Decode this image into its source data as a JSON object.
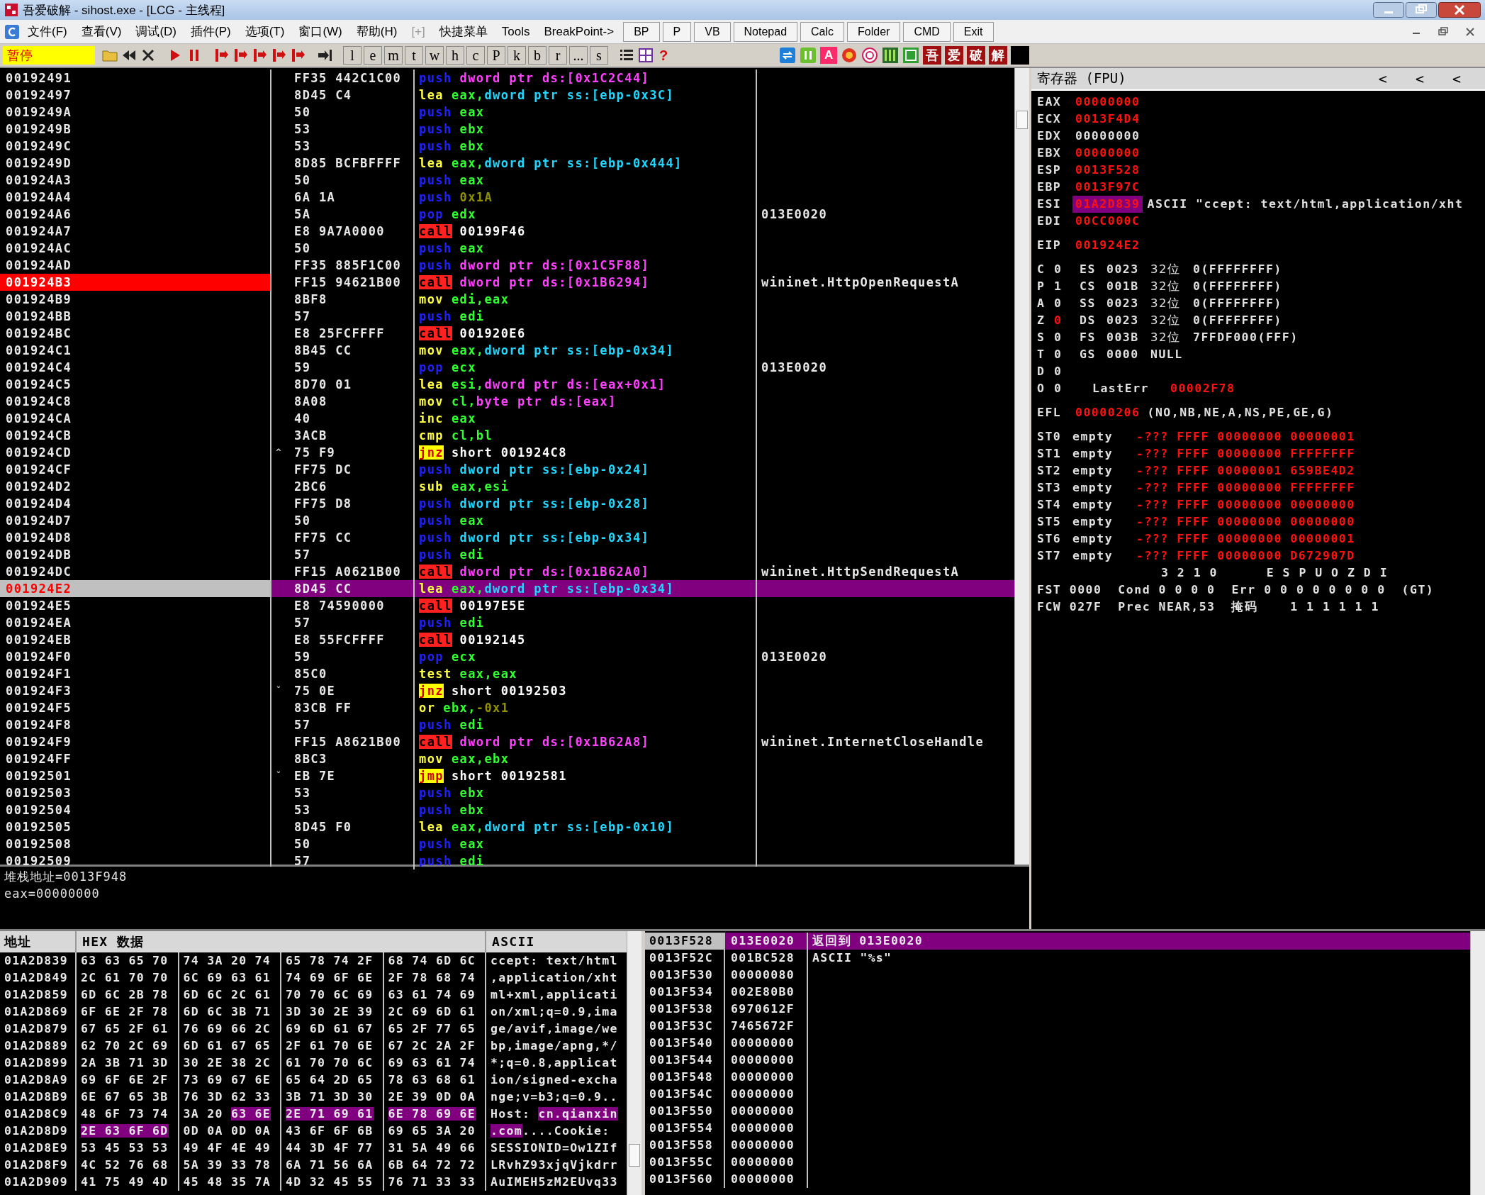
{
  "window": {
    "title": "吾爱破解 - sihost.exe - [LCG - 主线程]"
  },
  "menu": [
    {
      "label": "文件(F)",
      "disabled": false
    },
    {
      "label": "查看(V)",
      "disabled": false
    },
    {
      "label": "调试(D)",
      "disabled": false
    },
    {
      "label": "插件(P)",
      "disabled": false
    },
    {
      "label": "选项(T)",
      "disabled": false
    },
    {
      "label": "窗口(W)",
      "disabled": false
    },
    {
      "label": "帮助(H)",
      "disabled": false
    },
    {
      "label": "[+]",
      "disabled": true
    },
    {
      "label": "快捷菜单",
      "disabled": false
    },
    {
      "label": "Tools",
      "disabled": false
    },
    {
      "label": "BreakPoint->",
      "disabled": false
    }
  ],
  "quick_buttons": [
    "BP",
    "P",
    "VB",
    "Notepad",
    "Calc",
    "Folder",
    "CMD",
    "Exit"
  ],
  "toolbar": {
    "status": "暂停",
    "letter_buttons": [
      "l",
      "e",
      "m",
      "t",
      "w",
      "h",
      "c",
      "P",
      "k",
      "b",
      "r",
      "...",
      "s"
    ],
    "help_button": "?",
    "letter_icon": "A",
    "brand_buttons": [
      "吾",
      "爱",
      "破",
      "解"
    ]
  },
  "disassembly": {
    "rows": [
      {
        "address": "00192491",
        "bytes": "FF35 442C1C00",
        "mnemonic": {
          "text": "push",
          "kind": "stack"
        },
        "operands": [
          {
            "text": "dword ptr ds:[0x1C2C44]",
            "kind": "ds_mem"
          }
        ],
        "breakpoint": false,
        "selected": false
      },
      {
        "address": "00192497",
        "bytes": "8D45 C4",
        "mnemonic": {
          "text": "lea",
          "kind": "plain"
        },
        "operands": [
          {
            "text": "eax,",
            "kind": "reg"
          },
          {
            "text": "dword ptr ss:[ebp-0x3C]",
            "kind": "ss_mem"
          }
        ],
        "breakpoint": false,
        "selected": false
      },
      {
        "address": "0019249A",
        "bytes": "50",
        "mnemonic": {
          "text": "push",
          "kind": "stack"
        },
        "operands": [
          {
            "text": "eax",
            "kind": "reg"
          }
        ],
        "breakpoint": false,
        "selected": false
      },
      {
        "address": "0019249B",
        "bytes": "53",
        "mnemonic": {
          "text": "push",
          "kind": "stack"
        },
        "operands": [
          {
            "text": "ebx",
            "kind": "reg"
          }
        ],
        "breakpoint": false,
        "selected": false
      },
      {
        "address": "0019249C",
        "bytes": "53",
        "mnemonic": {
          "text": "push",
          "kind": "stack"
        },
        "operands": [
          {
            "text": "ebx",
            "kind": "reg"
          }
        ],
        "breakpoint": false,
        "selected": false
      },
      {
        "address": "0019249D",
        "bytes": "8D85 BCFBFFFF",
        "mnemonic": {
          "text": "lea",
          "kind": "plain"
        },
        "operands": [
          {
            "text": "eax,",
            "kind": "reg"
          },
          {
            "text": "dword ptr ss:[ebp-0x444]",
            "kind": "ss_mem"
          }
        ],
        "breakpoint": false,
        "selected": false
      },
      {
        "address": "001924A3",
        "bytes": "50",
        "mnemonic": {
          "text": "push",
          "kind": "stack"
        },
        "operands": [
          {
            "text": "eax",
            "kind": "reg"
          }
        ],
        "breakpoint": false,
        "selected": false
      },
      {
        "address": "001924A4",
        "bytes": "6A 1A",
        "mnemonic": {
          "text": "push",
          "kind": "stack"
        },
        "operands": [
          {
            "text": "0x1A",
            "kind": "imm"
          }
        ],
        "breakpoint": false,
        "selected": false
      },
      {
        "address": "001924A6",
        "bytes": "5A",
        "mnemonic": {
          "text": "pop",
          "kind": "stack"
        },
        "operands": [
          {
            "text": "edx",
            "kind": "reg"
          }
        ],
        "comment": "013E0020",
        "breakpoint": false,
        "selected": false
      },
      {
        "address": "001924A7",
        "bytes": "E8 9A7A0000",
        "mnemonic": {
          "text": "call",
          "kind": "call"
        },
        "operands": [
          {
            "text": "00199F46",
            "kind": "target"
          }
        ],
        "breakpoint": false,
        "selected": false
      },
      {
        "address": "001924AC",
        "bytes": "50",
        "mnemonic": {
          "text": "push",
          "kind": "stack"
        },
        "operands": [
          {
            "text": "eax",
            "kind": "reg"
          }
        ],
        "breakpoint": false,
        "selected": false
      },
      {
        "address": "001924AD",
        "bytes": "FF35 885F1C00",
        "mnemonic": {
          "text": "push",
          "kind": "stack"
        },
        "operands": [
          {
            "text": "dword ptr ds:[0x1C5F88]",
            "kind": "ds_mem"
          }
        ],
        "breakpoint": false,
        "selected": false
      },
      {
        "address": "001924B3",
        "bytes": "FF15 94621B00",
        "mnemonic": {
          "text": "call",
          "kind": "call"
        },
        "operands": [
          {
            "text": "dword ptr ds:[0x1B6294]",
            "kind": "ds_mem"
          }
        ],
        "comment": "wininet.HttpOpenRequestA",
        "breakpoint": true,
        "selected": false
      },
      {
        "address": "001924B9",
        "bytes": "8BF8",
        "mnemonic": {
          "text": "mov",
          "kind": "plain"
        },
        "operands": [
          {
            "text": "edi,eax",
            "kind": "reg"
          }
        ],
        "breakpoint": false,
        "selected": false
      },
      {
        "address": "001924BB",
        "bytes": "57",
        "mnemonic": {
          "text": "push",
          "kind": "stack"
        },
        "operands": [
          {
            "text": "edi",
            "kind": "reg"
          }
        ],
        "breakpoint": false,
        "selected": false
      },
      {
        "address": "001924BC",
        "bytes": "E8 25FCFFFF",
        "mnemonic": {
          "text": "call",
          "kind": "call"
        },
        "operands": [
          {
            "text": "001920E6",
            "kind": "target"
          }
        ],
        "breakpoint": false,
        "selected": false
      },
      {
        "address": "001924C1",
        "bytes": "8B45 CC",
        "mnemonic": {
          "text": "mov",
          "kind": "plain"
        },
        "operands": [
          {
            "text": "eax,",
            "kind": "reg"
          },
          {
            "text": "dword ptr ss:[ebp-0x34]",
            "kind": "ss_mem"
          }
        ],
        "breakpoint": false,
        "selected": false
      },
      {
        "address": "001924C4",
        "bytes": "59",
        "mnemonic": {
          "text": "pop",
          "kind": "stack"
        },
        "operands": [
          {
            "text": "ecx",
            "kind": "reg"
          }
        ],
        "comment": "013E0020",
        "breakpoint": false,
        "selected": false
      },
      {
        "address": "001924C5",
        "bytes": "8D70 01",
        "mnemonic": {
          "text": "lea",
          "kind": "plain"
        },
        "operands": [
          {
            "text": "esi,",
            "kind": "reg"
          },
          {
            "text": "dword ptr ds:[eax+0x1]",
            "kind": "ds_mem"
          }
        ],
        "breakpoint": false,
        "selected": false
      },
      {
        "address": "001924C8",
        "bytes": "8A08",
        "mnemonic": {
          "text": "mov",
          "kind": "plain"
        },
        "operands": [
          {
            "text": "cl,",
            "kind": "reg"
          },
          {
            "text": "byte ptr ds:[eax]",
            "kind": "ds_mem"
          }
        ],
        "breakpoint": false,
        "selected": false
      },
      {
        "address": "001924CA",
        "bytes": "40",
        "mnemonic": {
          "text": "inc",
          "kind": "plain"
        },
        "operands": [
          {
            "text": "eax",
            "kind": "reg"
          }
        ],
        "breakpoint": false,
        "selected": false
      },
      {
        "address": "001924CB",
        "bytes": "3ACB",
        "mnemonic": {
          "text": "cmp",
          "kind": "plain"
        },
        "operands": [
          {
            "text": "cl,bl",
            "kind": "reg"
          }
        ],
        "breakpoint": false,
        "selected": false
      },
      {
        "address": "001924CD",
        "jump_mark": "^",
        "bytes": "75 F9",
        "mnemonic": {
          "text": "jnz",
          "kind": "jump"
        },
        "operands": [
          {
            "text": "short 001924C8",
            "kind": "target"
          }
        ],
        "breakpoint": false,
        "selected": false
      },
      {
        "address": "001924CF",
        "bytes": "FF75 DC",
        "mnemonic": {
          "text": "push",
          "kind": "stack"
        },
        "operands": [
          {
            "text": "dword ptr ss:[ebp-0x24]",
            "kind": "ss_mem"
          }
        ],
        "breakpoint": false,
        "selected": false
      },
      {
        "address": "001924D2",
        "bytes": "2BC6",
        "mnemonic": {
          "text": "sub",
          "kind": "plain"
        },
        "operands": [
          {
            "text": "eax,esi",
            "kind": "reg"
          }
        ],
        "breakpoint": false,
        "selected": false
      },
      {
        "address": "001924D4",
        "bytes": "FF75 D8",
        "mnemonic": {
          "text": "push",
          "kind": "stack"
        },
        "operands": [
          {
            "text": "dword ptr ss:[ebp-0x28]",
            "kind": "ss_mem"
          }
        ],
        "breakpoint": false,
        "selected": false
      },
      {
        "address": "001924D7",
        "bytes": "50",
        "mnemonic": {
          "text": "push",
          "kind": "stack"
        },
        "operands": [
          {
            "text": "eax",
            "kind": "reg"
          }
        ],
        "breakpoint": false,
        "selected": false
      },
      {
        "address": "001924D8",
        "bytes": "FF75 CC",
        "mnemonic": {
          "text": "push",
          "kind": "stack"
        },
        "operands": [
          {
            "text": "dword ptr ss:[ebp-0x34]",
            "kind": "ss_mem"
          }
        ],
        "breakpoint": false,
        "selected": false
      },
      {
        "address": "001924DB",
        "bytes": "57",
        "mnemonic": {
          "text": "push",
          "kind": "stack"
        },
        "operands": [
          {
            "text": "edi",
            "kind": "reg"
          }
        ],
        "breakpoint": false,
        "selected": false
      },
      {
        "address": "001924DC",
        "bytes": "FF15 A0621B00",
        "mnemonic": {
          "text": "call",
          "kind": "call"
        },
        "operands": [
          {
            "text": "dword ptr ds:[0x1B62A0]",
            "kind": "ds_mem"
          }
        ],
        "comment": "wininet.HttpSendRequestA",
        "breakpoint": false,
        "selected": false
      },
      {
        "address": "001924E2",
        "bytes": "8D45 CC",
        "mnemonic": {
          "text": "lea",
          "kind": "plain"
        },
        "operands": [
          {
            "text": "eax,",
            "kind": "reg"
          },
          {
            "text": "dword ptr ss:[ebp-0x34]",
            "kind": "ss_mem"
          }
        ],
        "breakpoint": false,
        "selected": true
      },
      {
        "address": "001924E5",
        "bytes": "E8 74590000",
        "mnemonic": {
          "text": "call",
          "kind": "call"
        },
        "operands": [
          {
            "text": "00197E5E",
            "kind": "target"
          }
        ],
        "breakpoint": false,
        "selected": false
      },
      {
        "address": "001924EA",
        "bytes": "57",
        "mnemonic": {
          "text": "push",
          "kind": "stack"
        },
        "operands": [
          {
            "text": "edi",
            "kind": "reg"
          }
        ],
        "breakpoint": false,
        "selected": false
      },
      {
        "address": "001924EB",
        "bytes": "E8 55FCFFFF",
        "mnemonic": {
          "text": "call",
          "kind": "call"
        },
        "operands": [
          {
            "text": "00192145",
            "kind": "target"
          }
        ],
        "breakpoint": false,
        "selected": false
      },
      {
        "address": "001924F0",
        "bytes": "59",
        "mnemonic": {
          "text": "pop",
          "kind": "stack"
        },
        "operands": [
          {
            "text": "ecx",
            "kind": "reg"
          }
        ],
        "comment": "013E0020",
        "breakpoint": false,
        "selected": false
      },
      {
        "address": "001924F1",
        "bytes": "85C0",
        "mnemonic": {
          "text": "test",
          "kind": "plain"
        },
        "operands": [
          {
            "text": "eax,eax",
            "kind": "reg"
          }
        ],
        "breakpoint": false,
        "selected": false
      },
      {
        "address": "001924F3",
        "jump_mark": "ˇ",
        "bytes": "75 0E",
        "mnemonic": {
          "text": "jnz",
          "kind": "jump"
        },
        "operands": [
          {
            "text": "short 00192503",
            "kind": "target"
          }
        ],
        "breakpoint": false,
        "selected": false
      },
      {
        "address": "001924F5",
        "bytes": "83CB FF",
        "mnemonic": {
          "text": "or",
          "kind": "plain"
        },
        "operands": [
          {
            "text": "ebx,",
            "kind": "reg"
          },
          {
            "text": "-0x1",
            "kind": "imm"
          }
        ],
        "breakpoint": false,
        "selected": false
      },
      {
        "address": "001924F8",
        "bytes": "57",
        "mnemonic": {
          "text": "push",
          "kind": "stack"
        },
        "operands": [
          {
            "text": "edi",
            "kind": "reg"
          }
        ],
        "breakpoint": false,
        "selected": false
      },
      {
        "address": "001924F9",
        "bytes": "FF15 A8621B00",
        "mnemonic": {
          "text": "call",
          "kind": "call"
        },
        "operands": [
          {
            "text": "dword ptr ds:[0x1B62A8]",
            "kind": "ds_mem"
          }
        ],
        "comment": "wininet.InternetCloseHandle",
        "breakpoint": false,
        "selected": false
      },
      {
        "address": "001924FF",
        "bytes": "8BC3",
        "mnemonic": {
          "text": "mov",
          "kind": "plain"
        },
        "operands": [
          {
            "text": "eax,ebx",
            "kind": "reg"
          }
        ],
        "breakpoint": false,
        "selected": false
      },
      {
        "address": "00192501",
        "jump_mark": "ˇ",
        "bytes": "EB 7E",
        "mnemonic": {
          "text": "jmp",
          "kind": "jump"
        },
        "operands": [
          {
            "text": "short 00192581",
            "kind": "target"
          }
        ],
        "breakpoint": false,
        "selected": false
      },
      {
        "address": "00192503",
        "bytes": "53",
        "mnemonic": {
          "text": "push",
          "kind": "stack"
        },
        "operands": [
          {
            "text": "ebx",
            "kind": "reg"
          }
        ],
        "breakpoint": false,
        "selected": false
      },
      {
        "address": "00192504",
        "bytes": "53",
        "mnemonic": {
          "text": "push",
          "kind": "stack"
        },
        "operands": [
          {
            "text": "ebx",
            "kind": "reg"
          }
        ],
        "breakpoint": false,
        "selected": false
      },
      {
        "address": "00192505",
        "bytes": "8D45 F0",
        "mnemonic": {
          "text": "lea",
          "kind": "plain"
        },
        "operands": [
          {
            "text": "eax,",
            "kind": "reg"
          },
          {
            "text": "dword ptr ss:[ebp-0x10]",
            "kind": "ss_mem"
          }
        ],
        "breakpoint": false,
        "selected": false
      },
      {
        "address": "00192508",
        "bytes": "50",
        "mnemonic": {
          "text": "push",
          "kind": "stack"
        },
        "operands": [
          {
            "text": "eax",
            "kind": "reg"
          }
        ],
        "breakpoint": false,
        "selected": false
      },
      {
        "address": "00192509",
        "bytes": "57",
        "mnemonic": {
          "text": "push",
          "kind": "stack"
        },
        "operands": [
          {
            "text": "edi",
            "kind": "reg"
          }
        ],
        "breakpoint": false,
        "selected": false
      }
    ]
  },
  "info": {
    "lines": [
      "堆栈地址=0013F948",
      "eax=00000000"
    ]
  },
  "registers": {
    "title": "寄存器 (FPU)",
    "nav_buttons": [
      "<",
      "<",
      "<"
    ],
    "general": [
      {
        "name": "EAX",
        "value": "00000000",
        "changed": true,
        "selected": false
      },
      {
        "name": "ECX",
        "value": "0013F4D4",
        "changed": true,
        "selected": false
      },
      {
        "name": "EDX",
        "value": "00000000",
        "changed": false,
        "selected": false
      },
      {
        "name": "EBX",
        "value": "00000000",
        "changed": true,
        "selected": false
      },
      {
        "name": "ESP",
        "value": "0013F528",
        "changed": true,
        "selected": false
      },
      {
        "name": "EBP",
        "value": "0013F97C",
        "changed": true,
        "selected": false
      },
      {
        "name": "ESI",
        "value": "01A2D839",
        "changed": true,
        "selected": true,
        "comment": "ASCII \"ccept: text/html,application/xht"
      },
      {
        "name": "EDI",
        "value": "00CC000C",
        "changed": true,
        "selected": false
      }
    ],
    "eip": {
      "name": "EIP",
      "value": "001924E2",
      "changed": true
    },
    "flags": [
      {
        "flag": "C",
        "bit": "0",
        "changed": false,
        "segment": {
          "name": "ES",
          "selector": "0023",
          "width": "32位",
          "base": "0(FFFFFFFF)"
        }
      },
      {
        "flag": "P",
        "bit": "1",
        "changed": false,
        "segment": {
          "name": "CS",
          "selector": "001B",
          "width": "32位",
          "base": "0(FFFFFFFF)"
        }
      },
      {
        "flag": "A",
        "bit": "0",
        "changed": false,
        "segment": {
          "name": "SS",
          "selector": "0023",
          "width": "32位",
          "base": "0(FFFFFFFF)"
        }
      },
      {
        "flag": "Z",
        "bit": "0",
        "changed": true,
        "segment": {
          "name": "DS",
          "selector": "0023",
          "width": "32位",
          "base": "0(FFFFFFFF)"
        }
      },
      {
        "flag": "S",
        "bit": "0",
        "changed": false,
        "segment": {
          "name": "FS",
          "selector": "003B",
          "width": "32位",
          "base": "7FFDF000(FFF)"
        }
      },
      {
        "flag": "T",
        "bit": "0",
        "changed": false,
        "segment": {
          "name": "GS",
          "selector": "0000",
          "base": "NULL"
        }
      },
      {
        "flag": "D",
        "bit": "0",
        "changed": false
      },
      {
        "flag": "O",
        "bit": "0",
        "changed": false,
        "last_error": {
          "label": "LastErr",
          "value": "00002F78",
          "changed": true
        }
      }
    ],
    "efl": {
      "name": "EFL",
      "value": "00000206",
      "changed": true,
      "decoded": "(NO,NB,NE,A,NS,PE,GE,G)"
    },
    "fpu_stack": [
      {
        "name": "ST0",
        "tag": "empty",
        "value": "-??? FFFF 00000000 00000001",
        "changed": true
      },
      {
        "name": "ST1",
        "tag": "empty",
        "value": "-??? FFFF 00000000 FFFFFFFF",
        "changed": true
      },
      {
        "name": "ST2",
        "tag": "empty",
        "value": "-??? FFFF 00000001 659BE4D2",
        "changed": true
      },
      {
        "name": "ST3",
        "tag": "empty",
        "value": "-??? FFFF 00000000 FFFFFFFF",
        "changed": true
      },
      {
        "name": "ST4",
        "tag": "empty",
        "value": "-??? FFFF 00000000 00000000",
        "changed": true
      },
      {
        "name": "ST5",
        "tag": "empty",
        "value": "-??? FFFF 00000000 00000000",
        "changed": true
      },
      {
        "name": "ST6",
        "tag": "empty",
        "value": "-??? FFFF 00000000 00000001",
        "changed": true
      },
      {
        "name": "ST7",
        "tag": "empty",
        "value": "-??? FFFF 00000000 D672907D",
        "changed": true
      }
    ],
    "fpu_status": {
      "header": "3 2 1 0      E S P U O Z D I",
      "fst": "FST 0000  Cond 0 0 0 0  Err 0 0 0 0 0 0 0 0  (GT)",
      "fcw": "FCW 027F  Prec NEAR,53  掩码    1 1 1 1 1 1"
    }
  },
  "dump": {
    "columns": [
      "地址",
      "HEX 数据",
      "ASCII"
    ],
    "rows": [
      {
        "address": "01A2D839",
        "hex": [
          [
            {
              "text": "63 63 65 70",
              "selected": false
            }
          ],
          [
            {
              "text": "74 3A 20 74",
              "selected": false
            }
          ],
          [
            {
              "text": "65 78 74 2F",
              "selected": false
            }
          ],
          [
            {
              "text": "68 74 6D 6C",
              "selected": false
            }
          ]
        ],
        "ascii": [
          {
            "text": "ccept: text/html",
            "selected": false
          }
        ]
      },
      {
        "address": "01A2D849",
        "hex": [
          [
            {
              "text": "2C 61 70 70",
              "selected": false
            }
          ],
          [
            {
              "text": "6C 69 63 61",
              "selected": false
            }
          ],
          [
            {
              "text": "74 69 6F 6E",
              "selected": false
            }
          ],
          [
            {
              "text": "2F 78 68 74",
              "selected": false
            }
          ]
        ],
        "ascii": [
          {
            "text": ",application/xht",
            "selected": false
          }
        ]
      },
      {
        "address": "01A2D859",
        "hex": [
          [
            {
              "text": "6D 6C 2B 78",
              "selected": false
            }
          ],
          [
            {
              "text": "6D 6C 2C 61",
              "selected": false
            }
          ],
          [
            {
              "text": "70 70 6C 69",
              "selected": false
            }
          ],
          [
            {
              "text": "63 61 74 69",
              "selected": false
            }
          ]
        ],
        "ascii": [
          {
            "text": "ml+xml,applicati",
            "selected": false
          }
        ]
      },
      {
        "address": "01A2D869",
        "hex": [
          [
            {
              "text": "6F 6E 2F 78",
              "selected": false
            }
          ],
          [
            {
              "text": "6D 6C 3B 71",
              "selected": false
            }
          ],
          [
            {
              "text": "3D 30 2E 39",
              "selected": false
            }
          ],
          [
            {
              "text": "2C 69 6D 61",
              "selected": false
            }
          ]
        ],
        "ascii": [
          {
            "text": "on/xml;q=0.9,ima",
            "selected": false
          }
        ]
      },
      {
        "address": "01A2D879",
        "hex": [
          [
            {
              "text": "67 65 2F 61",
              "selected": false
            }
          ],
          [
            {
              "text": "76 69 66 2C",
              "selected": false
            }
          ],
          [
            {
              "text": "69 6D 61 67",
              "selected": false
            }
          ],
          [
            {
              "text": "65 2F 77 65",
              "selected": false
            }
          ]
        ],
        "ascii": [
          {
            "text": "ge/avif,image/we",
            "selected": false
          }
        ]
      },
      {
        "address": "01A2D889",
        "hex": [
          [
            {
              "text": "62 70 2C 69",
              "selected": false
            }
          ],
          [
            {
              "text": "6D 61 67 65",
              "selected": false
            }
          ],
          [
            {
              "text": "2F 61 70 6E",
              "selected": false
            }
          ],
          [
            {
              "text": "67 2C 2A 2F",
              "selected": false
            }
          ]
        ],
        "ascii": [
          {
            "text": "bp,image/apng,*/",
            "selected": false
          }
        ]
      },
      {
        "address": "01A2D899",
        "hex": [
          [
            {
              "text": "2A 3B 71 3D",
              "selected": false
            }
          ],
          [
            {
              "text": "30 2E 38 2C",
              "selected": false
            }
          ],
          [
            {
              "text": "61 70 70 6C",
              "selected": false
            }
          ],
          [
            {
              "text": "69 63 61 74",
              "selected": false
            }
          ]
        ],
        "ascii": [
          {
            "text": "*;q=0.8,applicat",
            "selected": false
          }
        ]
      },
      {
        "address": "01A2D8A9",
        "hex": [
          [
            {
              "text": "69 6F 6E 2F",
              "selected": false
            }
          ],
          [
            {
              "text": "73 69 67 6E",
              "selected": false
            }
          ],
          [
            {
              "text": "65 64 2D 65",
              "selected": false
            }
          ],
          [
            {
              "text": "78 63 68 61",
              "selected": false
            }
          ]
        ],
        "ascii": [
          {
            "text": "ion/signed-excha",
            "selected": false
          }
        ]
      },
      {
        "address": "01A2D8B9",
        "hex": [
          [
            {
              "text": "6E 67 65 3B",
              "selected": false
            }
          ],
          [
            {
              "text": "76 3D 62 33",
              "selected": false
            }
          ],
          [
            {
              "text": "3B 71 3D 30",
              "selected": false
            }
          ],
          [
            {
              "text": "2E 39 0D 0A",
              "selected": false
            }
          ]
        ],
        "ascii": [
          {
            "text": "nge;v=b3;q=0.9..",
            "selected": false
          }
        ]
      },
      {
        "address": "01A2D8C9",
        "hex": [
          [
            {
              "text": "48 6F 73 74",
              "selected": false
            }
          ],
          [
            {
              "text": "3A 20 ",
              "selected": false
            },
            {
              "text": "63 6E",
              "selected": true
            }
          ],
          [
            {
              "text": "2E 71 69 61",
              "selected": true
            }
          ],
          [
            {
              "text": "6E 78 69 6E",
              "selected": true
            }
          ]
        ],
        "ascii": [
          {
            "text": "Host: ",
            "selected": false
          },
          {
            "text": "cn.qianxin",
            "selected": true
          }
        ]
      },
      {
        "address": "01A2D8D9",
        "hex": [
          [
            {
              "text": "2E 63 6F 6D",
              "selected": true
            }
          ],
          [
            {
              "text": "0D 0A 0D 0A",
              "selected": false
            }
          ],
          [
            {
              "text": "43 6F 6F 6B",
              "selected": false
            }
          ],
          [
            {
              "text": "69 65 3A 20",
              "selected": false
            }
          ]
        ],
        "ascii": [
          {
            "text": ".com",
            "selected": true
          },
          {
            "text": "....Cookie: ",
            "selected": false
          }
        ]
      },
      {
        "address": "01A2D8E9",
        "hex": [
          [
            {
              "text": "53 45 53 53",
              "selected": false
            }
          ],
          [
            {
              "text": "49 4F 4E 49",
              "selected": false
            }
          ],
          [
            {
              "text": "44 3D 4F 77",
              "selected": false
            }
          ],
          [
            {
              "text": "31 5A 49 66",
              "selected": false
            }
          ]
        ],
        "ascii": [
          {
            "text": "SESSIONID=Ow1ZIf",
            "selected": false
          }
        ]
      },
      {
        "address": "01A2D8F9",
        "hex": [
          [
            {
              "text": "4C 52 76 68",
              "selected": false
            }
          ],
          [
            {
              "text": "5A 39 33 78",
              "selected": false
            }
          ],
          [
            {
              "text": "6A 71 56 6A",
              "selected": false
            }
          ],
          [
            {
              "text": "6B 64 72 72",
              "selected": false
            }
          ]
        ],
        "ascii": [
          {
            "text": "LRvhZ93xjqVjkdrr",
            "selected": false
          }
        ]
      },
      {
        "address": "01A2D909",
        "hex": [
          [
            {
              "text": "41 75 49 4D",
              "selected": false
            }
          ],
          [
            {
              "text": "45 48 35 7A",
              "selected": false
            }
          ],
          [
            {
              "text": "4D 32 45 55",
              "selected": false
            }
          ],
          [
            {
              "text": "76 71 33 33",
              "selected": false
            }
          ]
        ],
        "ascii": [
          {
            "text": "AuIMEH5zM2EUvq33",
            "selected": false
          }
        ]
      }
    ]
  },
  "stack": {
    "rows": [
      {
        "address": "0013F528",
        "value": "013E0020",
        "comment": "返回到 013E0020",
        "selected": true
      },
      {
        "address": "0013F52C",
        "value": "001BC528",
        "comment": "ASCII \"%s\"",
        "selected": false
      },
      {
        "address": "0013F530",
        "value": "00000080",
        "selected": false
      },
      {
        "address": "0013F534",
        "value": "002E80B0",
        "selected": false
      },
      {
        "address": "0013F538",
        "value": "6970612F",
        "selected": false
      },
      {
        "address": "0013F53C",
        "value": "7465672F",
        "selected": false
      },
      {
        "address": "0013F540",
        "value": "00000000",
        "selected": false
      },
      {
        "address": "0013F544",
        "value": "00000000",
        "selected": false
      },
      {
        "address": "0013F548",
        "value": "00000000",
        "selected": false
      },
      {
        "address": "0013F54C",
        "value": "00000000",
        "selected": false
      },
      {
        "address": "0013F550",
        "value": "00000000",
        "selected": false
      },
      {
        "address": "0013F554",
        "value": "00000000",
        "selected": false
      },
      {
        "address": "0013F558",
        "value": "00000000",
        "selected": false
      },
      {
        "address": "0013F55C",
        "value": "00000000",
        "selected": false
      },
      {
        "address": "0013F560",
        "value": "00000000",
        "selected": false
      }
    ]
  }
}
